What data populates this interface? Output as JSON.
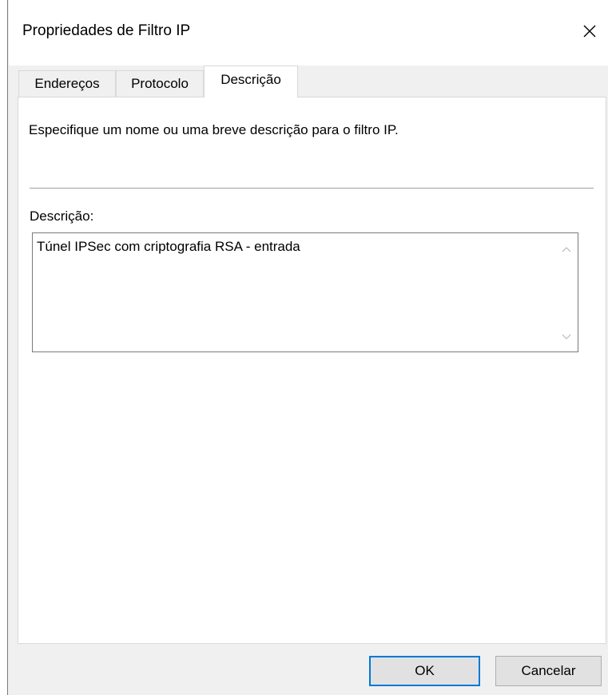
{
  "window": {
    "title": "Propriedades de Filtro IP",
    "close_icon": "close-icon"
  },
  "tabs": [
    {
      "label": "Endereços",
      "active": false
    },
    {
      "label": "Protocolo",
      "active": false
    },
    {
      "label": "Descrição",
      "active": true
    }
  ],
  "panel": {
    "instruction": "Especifique um nome ou uma breve descrição para o filtro IP.",
    "description_label": "Descrição:",
    "description_value": "Túnel IPSec com criptografia RSA - entrada"
  },
  "buttons": {
    "ok": "OK",
    "cancel": "Cancelar"
  },
  "colors": {
    "dialog_bg": "#f0f0f0",
    "panel_bg": "#ffffff",
    "default_button_border": "#0078d7"
  }
}
